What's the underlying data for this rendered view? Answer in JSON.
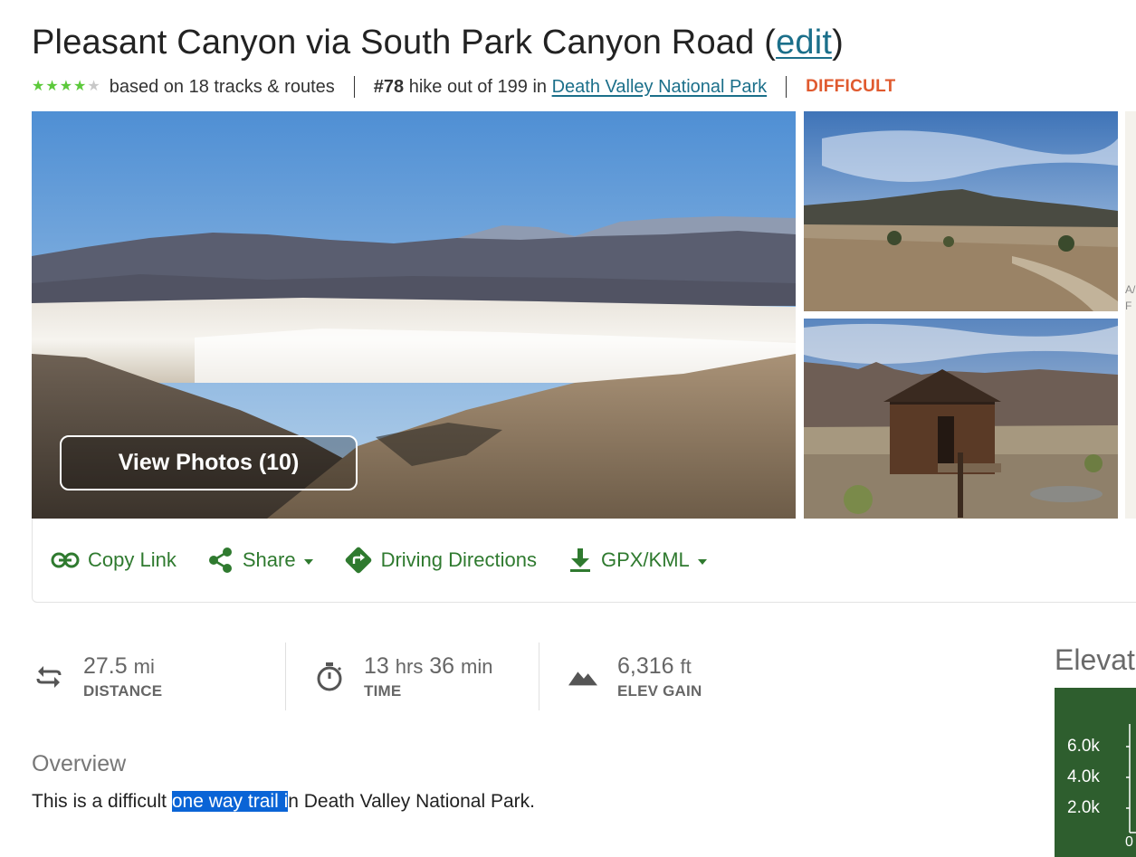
{
  "header": {
    "title_main": "Pleasant Canyon via South Park Canyon Road (",
    "edit_link": "edit",
    "title_close": ")",
    "rating_stars": 4,
    "rating_text": "based on 18 tracks & routes",
    "rank_number": "#78",
    "rank_text": " hike out of 199 in ",
    "park_link": "Death Valley National Park",
    "difficulty": "DIFFICULT"
  },
  "gallery": {
    "view_photos_label": "View Photos (10)",
    "sliver_text_1": "A/",
    "sliver_text_2": "F"
  },
  "actions": {
    "copy_link": "Copy Link",
    "share": "Share",
    "driving_directions": "Driving Directions",
    "gpx_kml": "GPX/KML"
  },
  "stats": [
    {
      "value": "27.5",
      "unit": "mi",
      "label": "DISTANCE",
      "icon": "distance-icon"
    },
    {
      "value_a": "13",
      "unit_a": "hrs",
      "value_b": "36",
      "unit_b": "min",
      "label": "TIME",
      "icon": "stopwatch-icon"
    },
    {
      "value": "6,316",
      "unit": "ft",
      "label": "ELEV GAIN",
      "icon": "mountain-icon"
    }
  ],
  "overview": {
    "heading": "Overview",
    "text_before": "This is a difficult ",
    "text_highlight": "one way trail i",
    "text_after": "n Death Valley National Park."
  },
  "elevation": {
    "title": "Elevat",
    "ticks": [
      "6.0k",
      "4.0k",
      "2.0k"
    ],
    "axis_start": "0"
  },
  "colors": {
    "accent_green": "#2f7a2f",
    "link_teal": "#1b6f8a",
    "difficulty_orange": "#e05a2f",
    "star_green": "#5cc93b",
    "chart_bg": "#2e5e2e",
    "selection_blue": "#0a64d6"
  }
}
